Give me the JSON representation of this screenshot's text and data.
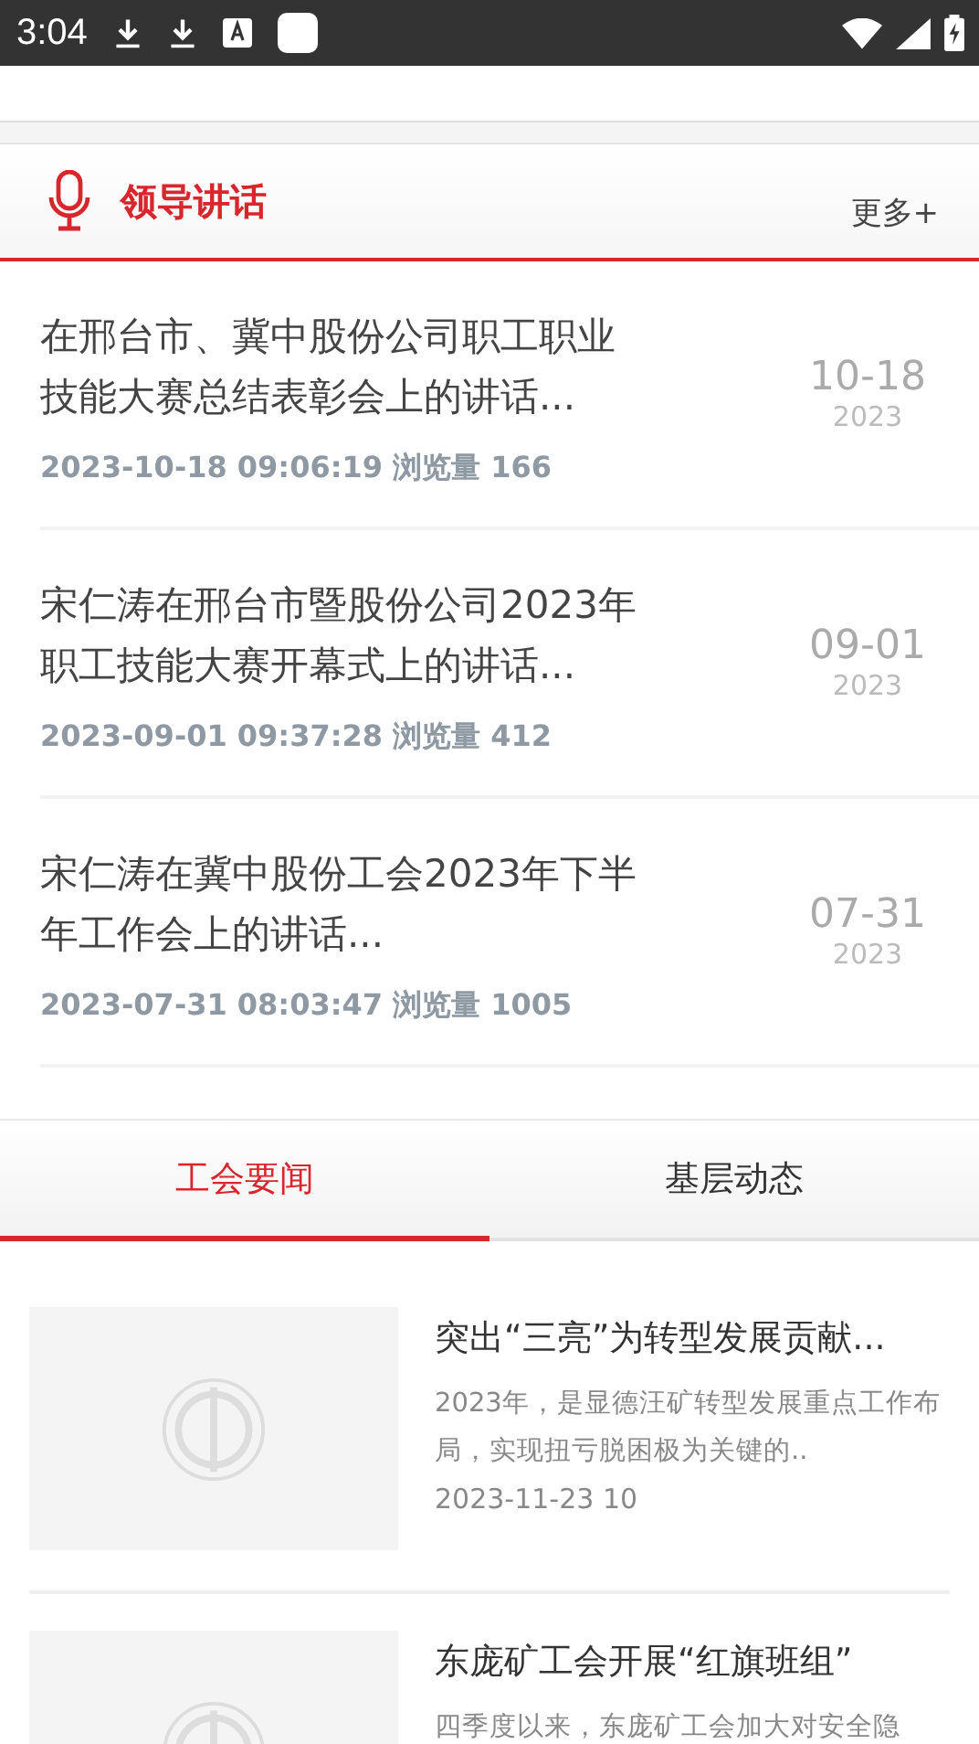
{
  "status_bar": {
    "time": "3:04"
  },
  "speech_section": {
    "title": "领导讲话",
    "more": "更多+",
    "items": [
      {
        "title": "在邢台市、冀中股份公司职工职业技能大赛总结表彰会上的讲话...",
        "meta": "2023-10-18 09:06:19 浏览量 166",
        "day": "10-18",
        "year": "2023"
      },
      {
        "title": "宋仁涛在邢台市暨股份公司2023年职工技能大赛开幕式上的讲话...",
        "meta": "2023-09-01 09:37:28 浏览量 412",
        "day": "09-01",
        "year": "2023"
      },
      {
        "title": "宋仁涛在冀中股份工会2023年下半年工作会上的讲话...",
        "meta": "2023-07-31 08:03:47 浏览量 1005",
        "day": "07-31",
        "year": "2023"
      }
    ]
  },
  "tabs": [
    {
      "label": "工会要闻",
      "selected": true
    },
    {
      "label": "基层动态",
      "selected": false
    }
  ],
  "news": [
    {
      "title": "突出“三亮”为转型发展贡献...",
      "summary": "2023年，是显德汪矿转型发展重点工作布局，实现扭亏脱困极为关键的..",
      "date": "2023-11-23 10"
    },
    {
      "title": "东庞矿工会开展“红旗班组”",
      "summary": "四季度以来，东庞矿工会加大对安全隐"
    }
  ]
}
